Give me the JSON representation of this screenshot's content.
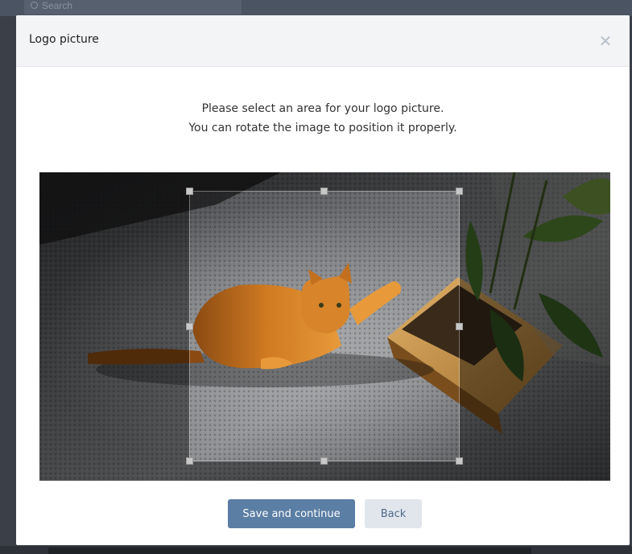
{
  "background_page": {
    "search_placeholder": "Search"
  },
  "modal": {
    "title": "Logo picture",
    "close_icon": "close-icon",
    "instructions_line1": "Please select an area for your logo picture.",
    "instructions_line2": "You can rotate the image to position it properly.",
    "image_description_icon": "photo-of-orange-cat",
    "buttons": {
      "primary_label": "Save and continue",
      "secondary_label": "Back"
    }
  },
  "colors": {
    "primary_button": "#5b7ea4",
    "secondary_button": "#e1e6ed",
    "secondary_text": "#4f6a88",
    "header_bg": "#f3f4f6"
  }
}
